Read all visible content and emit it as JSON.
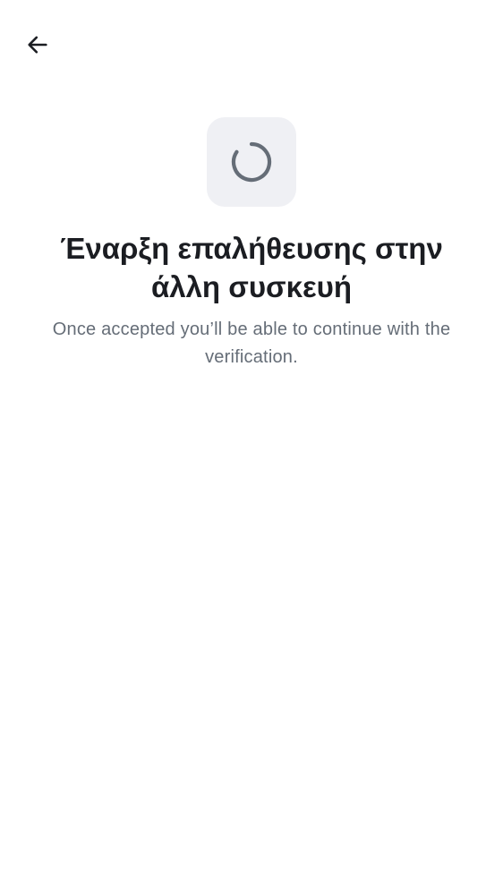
{
  "header": {
    "back_icon": "arrow-left-icon"
  },
  "status": {
    "icon": "loading-spinner-icon",
    "tile_color": "#eff0f4",
    "spinner_color": "#656d77"
  },
  "content": {
    "title": "Έναρξη επαλήθευσης στην άλλη συσκευή",
    "subtitle": "Once accepted you’ll be able to continue with the verification."
  },
  "colors": {
    "title": "#1b1d22",
    "subtitle": "#656d77",
    "background": "#ffffff"
  }
}
